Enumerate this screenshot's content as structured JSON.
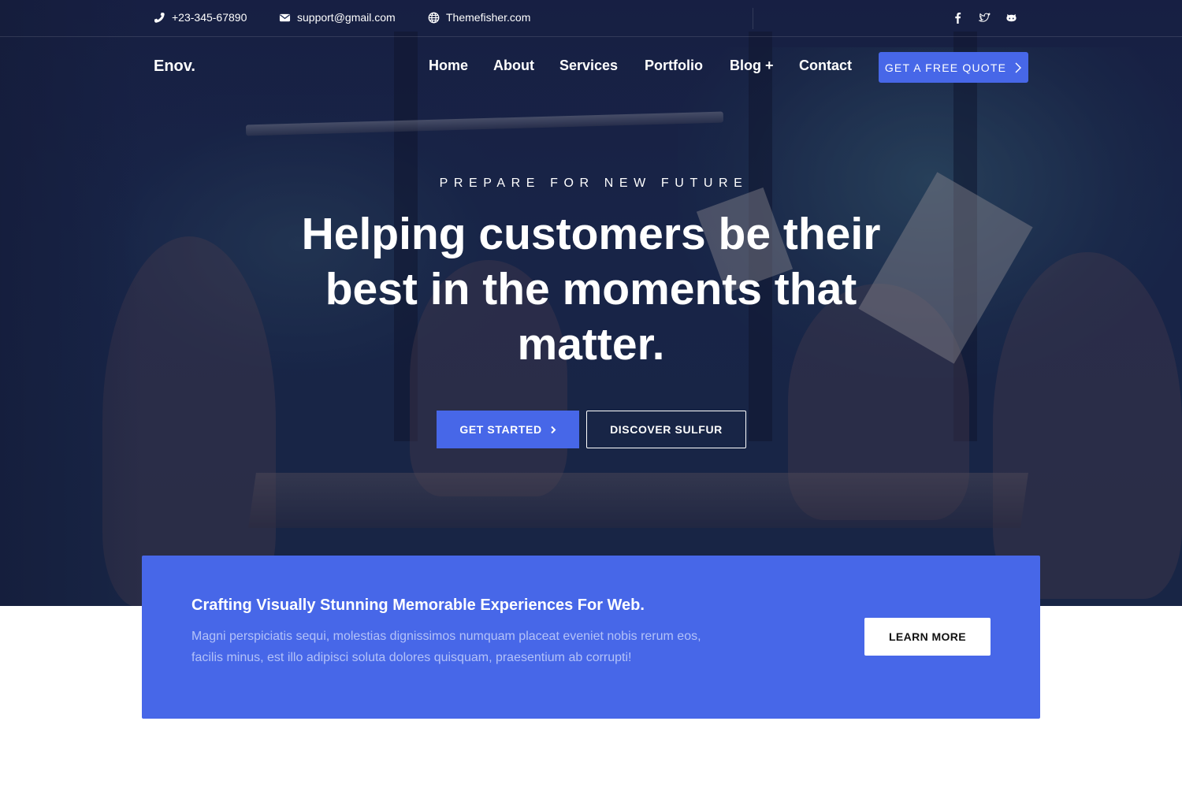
{
  "topbar": {
    "phone": "+23-345-67890",
    "email": "support@gmail.com",
    "website": "Themefisher.com",
    "social_icons": [
      "facebook-icon",
      "twitter-icon",
      "github-icon"
    ]
  },
  "header": {
    "logo": "Enov.",
    "nav": [
      "Home",
      "About",
      "Services",
      "Portfolio",
      "Blog +",
      "Contact"
    ],
    "quote_button": "GET A FREE QUOTE"
  },
  "hero": {
    "eyebrow": "PREPARE FOR NEW FUTURE",
    "headline_lines": [
      "Helping customers be their",
      "best in the moments that",
      "matter."
    ],
    "primary_button": "GET STARTED",
    "secondary_button": "DISCOVER SULFUR"
  },
  "cta": {
    "title": "Crafting Visually Stunning Memorable Experiences For Web.",
    "text_lines": [
      "Magni perspiciatis sequi, molestias dignissimos numquam placeat eveniet nobis rerum eos,",
      "facilis minus, est illo adipisci soluta dolores quisquam, praesentium ab corrupti!"
    ],
    "button": "LEARN MORE"
  },
  "colors": {
    "accent": "#4767e8",
    "hero_overlay": "#1b2347",
    "text_light": "#ffffff"
  }
}
